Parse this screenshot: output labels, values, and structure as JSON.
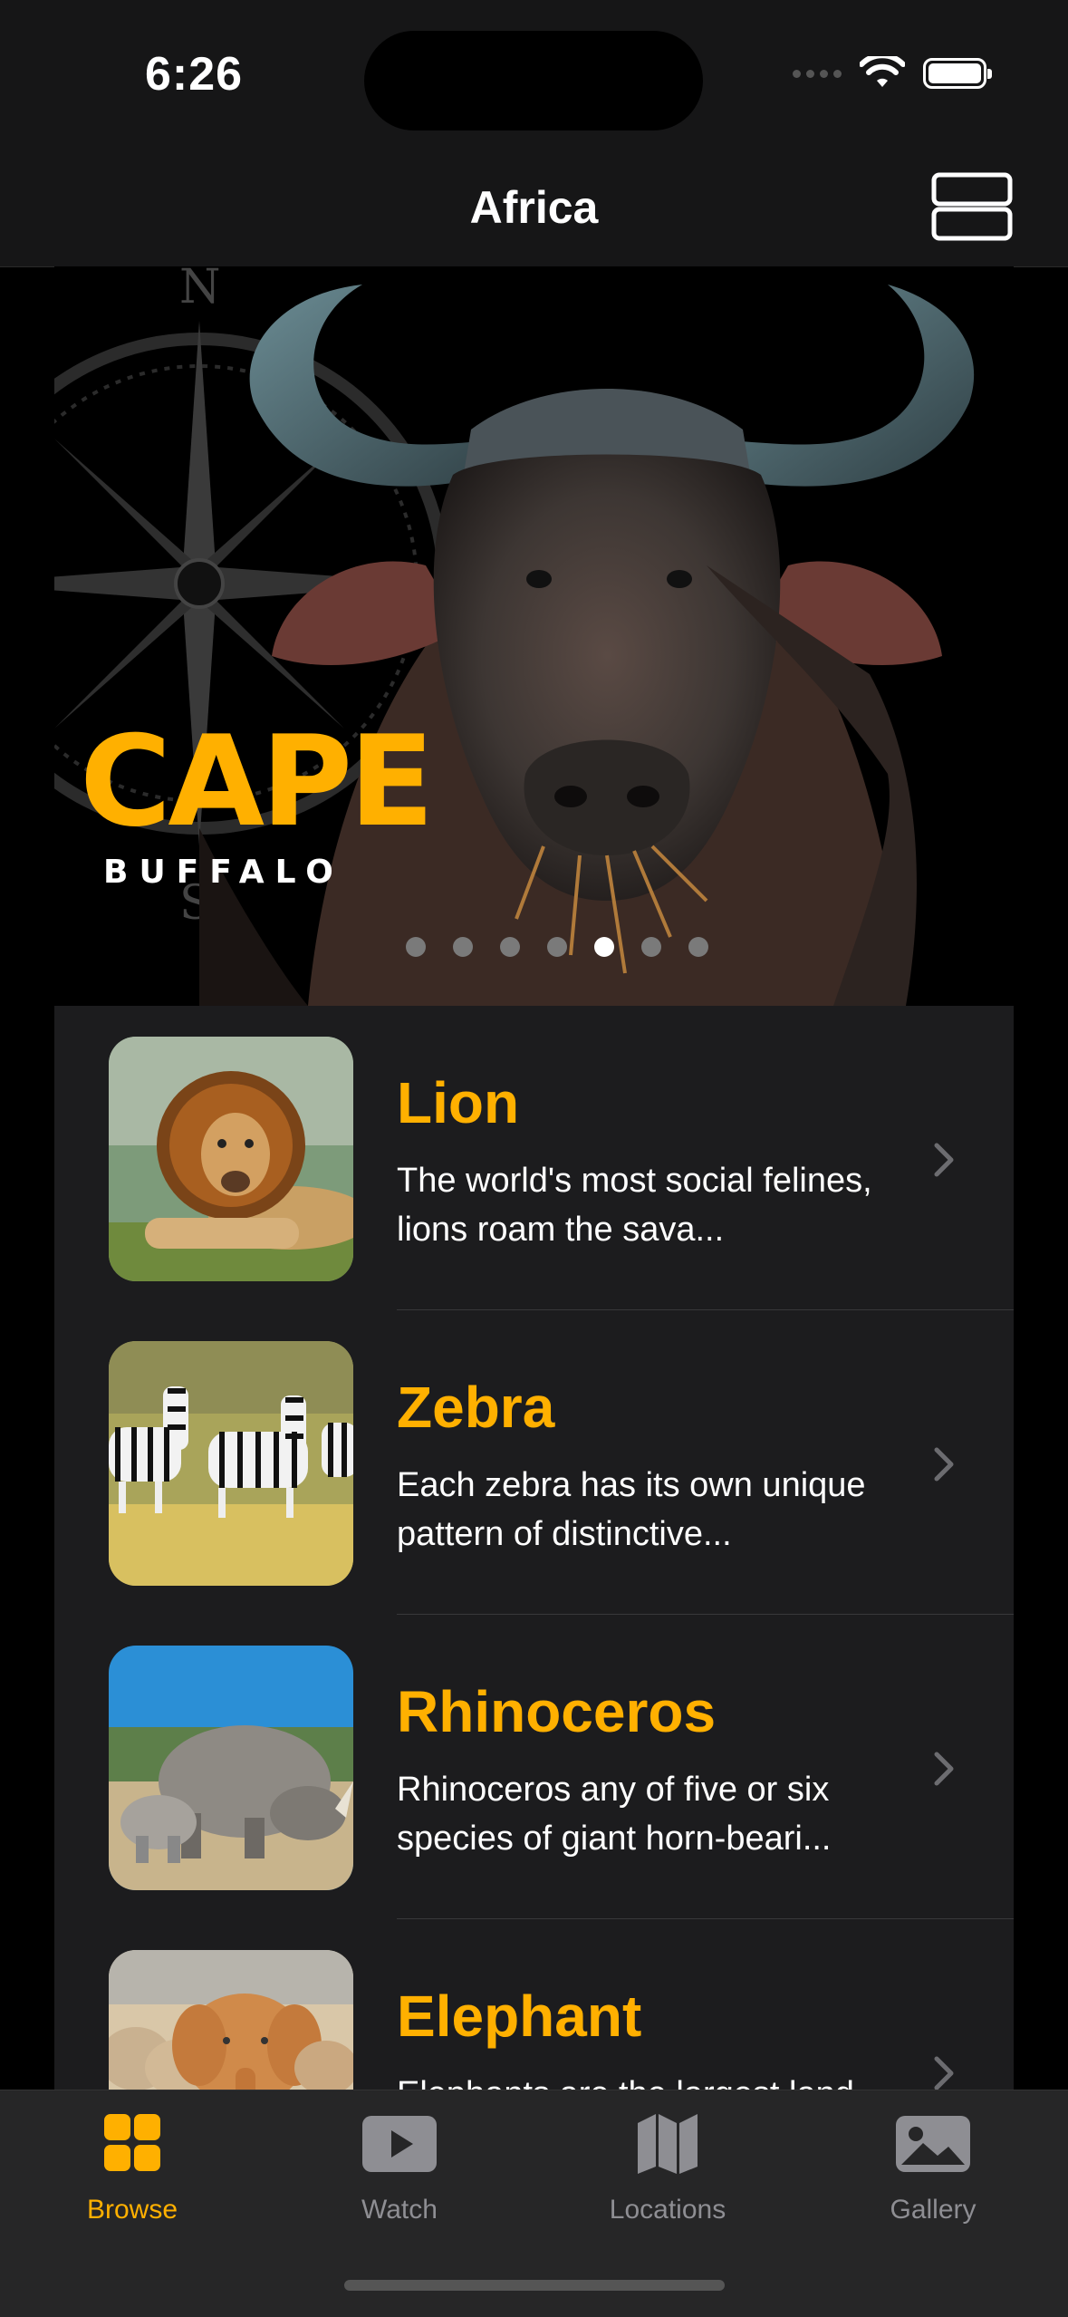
{
  "status_bar": {
    "time": "6:26"
  },
  "nav": {
    "title": "Africa"
  },
  "hero": {
    "title": "CAPE",
    "subtitle": "BUFFALO",
    "page_count": 7,
    "active_page": 5
  },
  "animals": [
    {
      "name": "Lion",
      "desc": "The world's most social felines, lions roam the sava..."
    },
    {
      "name": "Zebra",
      "desc": "Each zebra has its own unique pattern of distinctive..."
    },
    {
      "name": "Rhinoceros",
      "desc": "Rhinoceros any of five or six species of giant horn-beari..."
    },
    {
      "name": "Elephant",
      "desc": "Elephants are the largest land"
    }
  ],
  "tabs": [
    {
      "label": "Browse",
      "icon": "grid-icon",
      "active": true
    },
    {
      "label": "Watch",
      "icon": "play-icon",
      "active": false
    },
    {
      "label": "Locations",
      "icon": "map-icon",
      "active": false
    },
    {
      "label": "Gallery",
      "icon": "photo-icon",
      "active": false
    }
  ],
  "colors": {
    "accent": "#FFB000",
    "background": "#1C1C1E",
    "bar": "#161617"
  }
}
